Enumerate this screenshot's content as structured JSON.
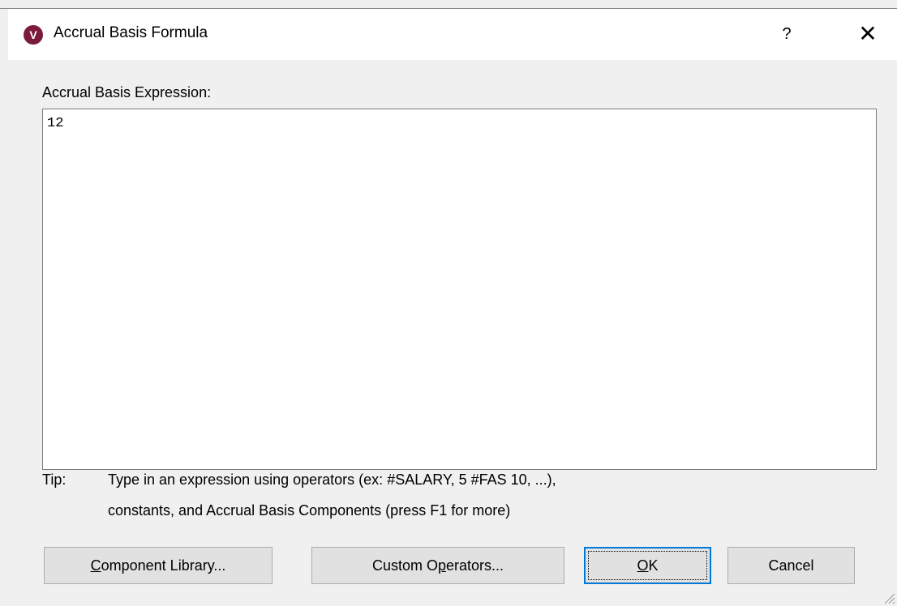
{
  "window": {
    "title": "Accrual Basis Formula",
    "app_icon_letter": "V",
    "help_glyph": "?",
    "close_glyph": "✕"
  },
  "expression": {
    "label": "Accrual Basis Expression:",
    "value": "12"
  },
  "tip": {
    "label": "Tip:",
    "line1": "Type in an expression using operators (ex: #SALARY, 5 #FAS 10, ...),",
    "line2": "constants, and Accrual Basis Components (press F1 for more)"
  },
  "buttons": {
    "component_library": {
      "mnemonic": "C",
      "rest": "omponent Library..."
    },
    "custom_operators": {
      "pre": "Custom O",
      "mnemonic": "p",
      "rest": "erators..."
    },
    "ok": {
      "mnemonic": "O",
      "rest": "K"
    },
    "cancel": "Cancel"
  },
  "colors": {
    "app_icon_bg": "#7b1a3c",
    "default_button_border": "#0078d7",
    "dialog_bg": "#f0f0f0"
  }
}
